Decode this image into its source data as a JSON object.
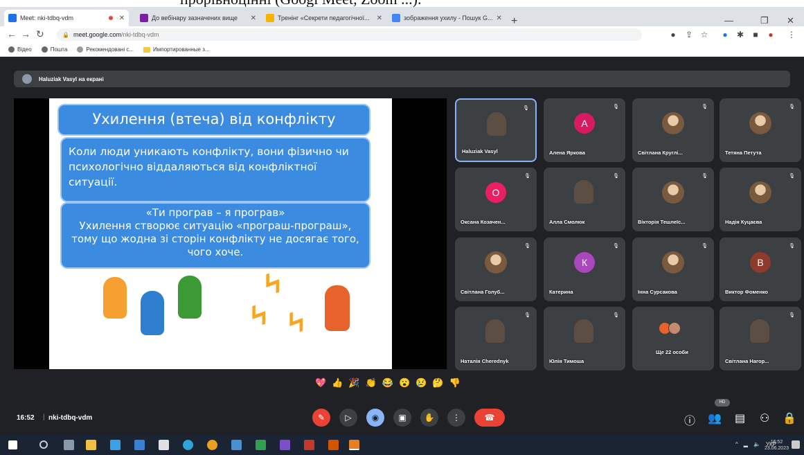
{
  "caption": {
    "text": "прорівноцінні (Googl Meet, Zoom ...)."
  },
  "browser": {
    "tabs": [
      {
        "label": "Meet: nki-tdbq-vdm",
        "color": "#1a73e8",
        "active": true
      },
      {
        "label": "До вебінару зазначених вище",
        "color": "#7b1fa2"
      },
      {
        "label": "Тренінг «Секрети педагогічної...",
        "color": "#f4b400"
      },
      {
        "label": "зображення ухилу - Пошук G...",
        "color": "#4285f4"
      }
    ],
    "new_tab": "+",
    "url_host": "meet.google.com",
    "url_path": "/nki-tdbq-vdm",
    "bookmarks": [
      "Відео",
      "Пошта",
      "Рекомендовані с...",
      "Импортированные з..."
    ]
  },
  "meet": {
    "presenter_label": "Haluziak Vasyl на екрані",
    "slide": {
      "title": "Ухилення (втеча) від конфлікту",
      "body1": "Коли люди уникають конфлікту, вони фізично чи психологічно віддаляються від конфліктної ситуації.",
      "body2_head": "«Ти програв – я програв»",
      "body2": "Ухилення створює ситуацію «програш-програш», тому що жодна зі сторін конфлікту не досягає того, чого хоче."
    },
    "participants": [
      {
        "name": "Haluziak Vasyl",
        "kind": "video",
        "initial": ""
      },
      {
        "name": "Алена Яркова",
        "kind": "initial",
        "initial": "А",
        "color": "#d81b60"
      },
      {
        "name": "Світлана Круглі...",
        "kind": "photo",
        "initial": ""
      },
      {
        "name": "Тетяна Петута",
        "kind": "photo",
        "initial": ""
      },
      {
        "name": "Оксана Козачен...",
        "kind": "initial",
        "initial": "О",
        "color": "#e91e63"
      },
      {
        "name": "Алла Смолюк",
        "kind": "video2",
        "initial": ""
      },
      {
        "name": "Вікторія Тешлеїс...",
        "kind": "photo",
        "initial": ""
      },
      {
        "name": "Надія Куцаєва",
        "kind": "photo",
        "initial": ""
      },
      {
        "name": "Світлана Голуб...",
        "kind": "photo",
        "initial": ""
      },
      {
        "name": "Катерина",
        "kind": "initial",
        "initial": "К",
        "color": "#ab47bc"
      },
      {
        "name": "Інна Сурсакова",
        "kind": "photo",
        "initial": ""
      },
      {
        "name": "Виктор Фоменко",
        "kind": "initial",
        "initial": "В",
        "color": "#8d3b2b"
      },
      {
        "name": "Наталія Cherednyk",
        "kind": "video3",
        "initial": ""
      },
      {
        "name": "Юлія Тимоша",
        "kind": "video4",
        "initial": ""
      },
      {
        "name": "Ще 22 особи",
        "kind": "more",
        "initial": ""
      },
      {
        "name": "Світлана Нагор...",
        "kind": "video5",
        "initial": ""
      }
    ],
    "reactions": [
      "💖",
      "👍",
      "🎉",
      "👏",
      "😂",
      "😮",
      "😢",
      "🤔",
      "👎"
    ],
    "time": "16:52",
    "meeting_code": "nki-tdbq-vdm",
    "hd_badge": "HD"
  },
  "taskbar": {
    "lang": "УКР",
    "time": "16:52",
    "date": "23.06.2023"
  }
}
